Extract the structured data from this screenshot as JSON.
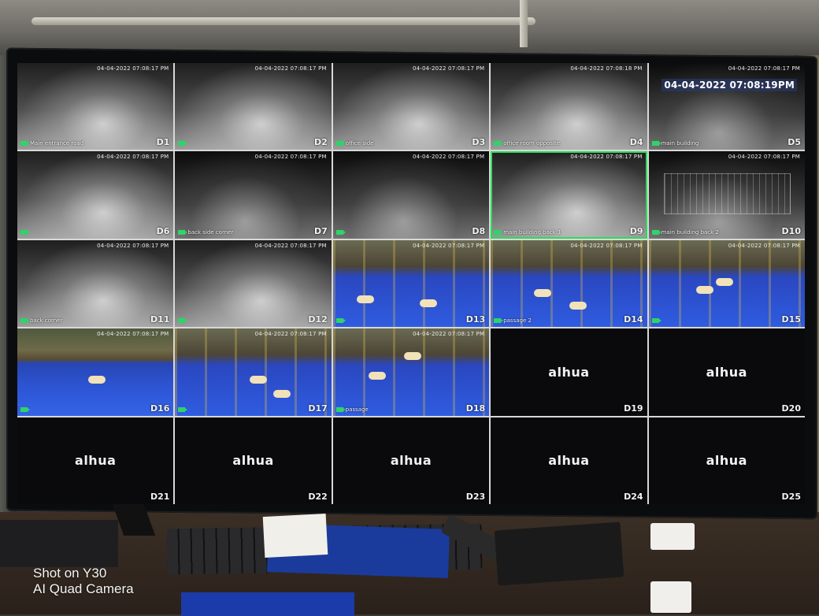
{
  "photo_watermark": {
    "line1": "Shot on Y30",
    "line2": "AI Quad Camera"
  },
  "dvr": {
    "brand_logo": "alhua",
    "timestamp_small": "04-04-2022 07:08:17 PM",
    "timestamp_small_d4": "04-04-2022 07:08:18 PM",
    "timestamp_d5_big": "04-04-2022 07:08:19PM",
    "cameras": [
      {
        "id": "D1",
        "label": "Main entrance road",
        "kind": "night"
      },
      {
        "id": "D2",
        "label": "",
        "kind": "night"
      },
      {
        "id": "D3",
        "label": "office side",
        "kind": "night"
      },
      {
        "id": "D4",
        "label": "office room opposite",
        "kind": "night"
      },
      {
        "id": "D5",
        "label": "main building",
        "kind": "night"
      },
      {
        "id": "D6",
        "label": "",
        "kind": "night"
      },
      {
        "id": "D7",
        "label": "back side corner",
        "kind": "night"
      },
      {
        "id": "D8",
        "label": "",
        "kind": "night"
      },
      {
        "id": "D9",
        "label": "main building back 1",
        "kind": "night"
      },
      {
        "id": "D10",
        "label": "main building back 2",
        "kind": "night"
      },
      {
        "id": "D11",
        "label": "back corner",
        "kind": "night"
      },
      {
        "id": "D12",
        "label": "",
        "kind": "night"
      },
      {
        "id": "D13",
        "label": "",
        "kind": "color"
      },
      {
        "id": "D14",
        "label": "passage 2",
        "kind": "color"
      },
      {
        "id": "D15",
        "label": "",
        "kind": "color"
      },
      {
        "id": "D16",
        "label": "",
        "kind": "color"
      },
      {
        "id": "D17",
        "label": "",
        "kind": "color"
      },
      {
        "id": "D18",
        "label": "passage",
        "kind": "color"
      },
      {
        "id": "D19",
        "label": "",
        "kind": "logo"
      },
      {
        "id": "D20",
        "label": "",
        "kind": "logo"
      },
      {
        "id": "D21",
        "label": "",
        "kind": "logo"
      },
      {
        "id": "D22",
        "label": "",
        "kind": "logo"
      },
      {
        "id": "D23",
        "label": "",
        "kind": "logo"
      },
      {
        "id": "D24",
        "label": "",
        "kind": "logo"
      },
      {
        "id": "D25",
        "label": "",
        "kind": "logo"
      }
    ]
  }
}
